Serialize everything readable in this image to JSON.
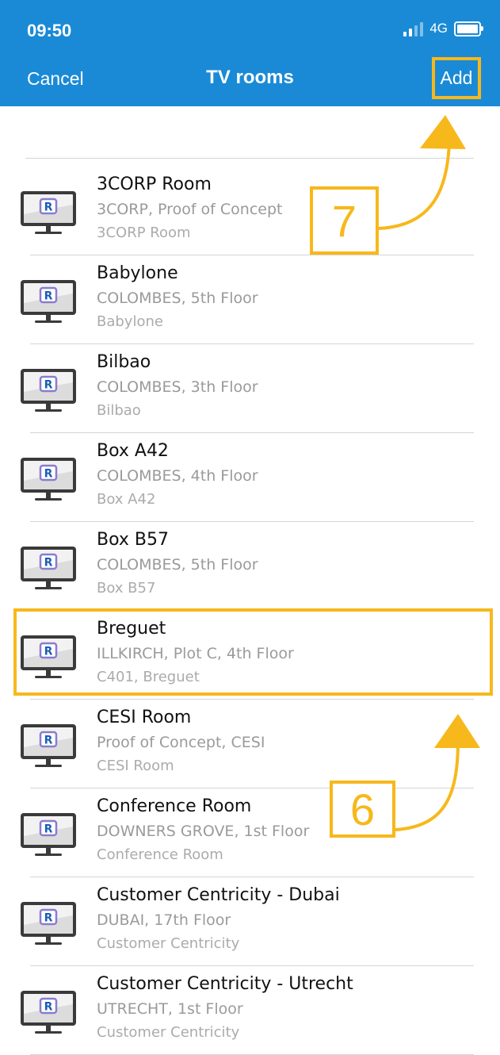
{
  "status_bar": {
    "time": "09:50",
    "network": "4G"
  },
  "nav": {
    "cancel_label": "Cancel",
    "title": "TV rooms",
    "add_label": "Add"
  },
  "rooms": [
    {
      "name": "3CORP Room",
      "location": "3CORP, Proof of Concept",
      "detail": "3CORP Room"
    },
    {
      "name": "Babylone",
      "location": "COLOMBES, 5th Floor",
      "detail": "Babylone"
    },
    {
      "name": "Bilbao",
      "location": "COLOMBES, 3th Floor",
      "detail": "Bilbao"
    },
    {
      "name": "Box A42",
      "location": "COLOMBES, 4th Floor",
      "detail": "Box A42"
    },
    {
      "name": "Box B57",
      "location": "COLOMBES, 5th Floor",
      "detail": "Box B57"
    },
    {
      "name": "Breguet",
      "location": "ILLKIRCH, Plot C, 4th Floor",
      "detail": "C401, Breguet"
    },
    {
      "name": "CESI Room",
      "location": "Proof of Concept, CESI",
      "detail": "CESI Room"
    },
    {
      "name": "Conference Room",
      "location": "DOWNERS GROVE, 1st Floor",
      "detail": "Conference Room"
    },
    {
      "name": "Customer Centricity - Dubai",
      "location": "DUBAI, 17th Floor",
      "detail": "Customer Centricity"
    },
    {
      "name": "Customer Centricity - Utrecht",
      "location": "UTRECHT, 1st Floor",
      "detail": "Customer Centricity"
    }
  ],
  "annotations": {
    "step_add": "7",
    "step_select": "6"
  },
  "colors": {
    "header_bg": "#1a8ad6",
    "annotation": "#f7b81b"
  },
  "icons": {
    "room": "tv-monitor-icon"
  }
}
